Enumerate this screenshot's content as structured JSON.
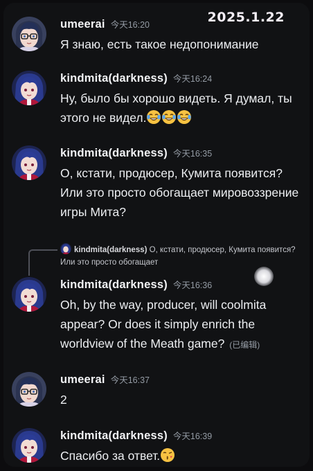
{
  "date_stamp": "2025.1.22",
  "messages": [
    {
      "author": "umeerai",
      "time": "今天16:20",
      "text": "Я знаю, есть такое недопонимание",
      "avatar": "glasses-avatar-icon"
    },
    {
      "author": "kindmita(darkness)",
      "time": "今天16:24",
      "text": "Ну, было бы хорошо видеть.  Я думал, ты этого не видел.",
      "emojis": [
        "tears-of-joy-emoji",
        "tears-of-joy-emoji",
        "tears-of-joy-emoji"
      ],
      "avatar": "dark-hair-avatar-icon"
    },
    {
      "author": "kindmita(darkness)",
      "time": "今天16:35",
      "text": "О, кстати, продюсер, Кумита появится? Или это просто обогащает мировоззрение игры Мита?",
      "avatar": "dark-hair-avatar-icon"
    },
    {
      "author": "kindmita(darkness)",
      "time": "今天16:36",
      "text": "Oh, by the way, producer, will coolmita appear? Or does it simply enrich the worldview of the Meath game?",
      "edited": "(已编辑)",
      "avatar": "dark-hair-avatar-icon"
    },
    {
      "author": "umeerai",
      "time": "今天16:37",
      "text": "2",
      "avatar": "glasses-avatar-icon"
    },
    {
      "author": "kindmita(darkness)",
      "time": "今天16:39",
      "text": "Спасибо за ответ.",
      "emojis": [
        "kiss-emoji"
      ],
      "avatar": "dark-hair-avatar-icon"
    }
  ],
  "reply": {
    "author": "kindmita(darkness)",
    "text": "О, кстати, продюсер, Кумита появится?  Или это просто обогащает"
  },
  "colors": {
    "background": "#111214",
    "author": "#f2f3f5",
    "timestamp": "#949ba4",
    "message_text": "#eceef1"
  }
}
